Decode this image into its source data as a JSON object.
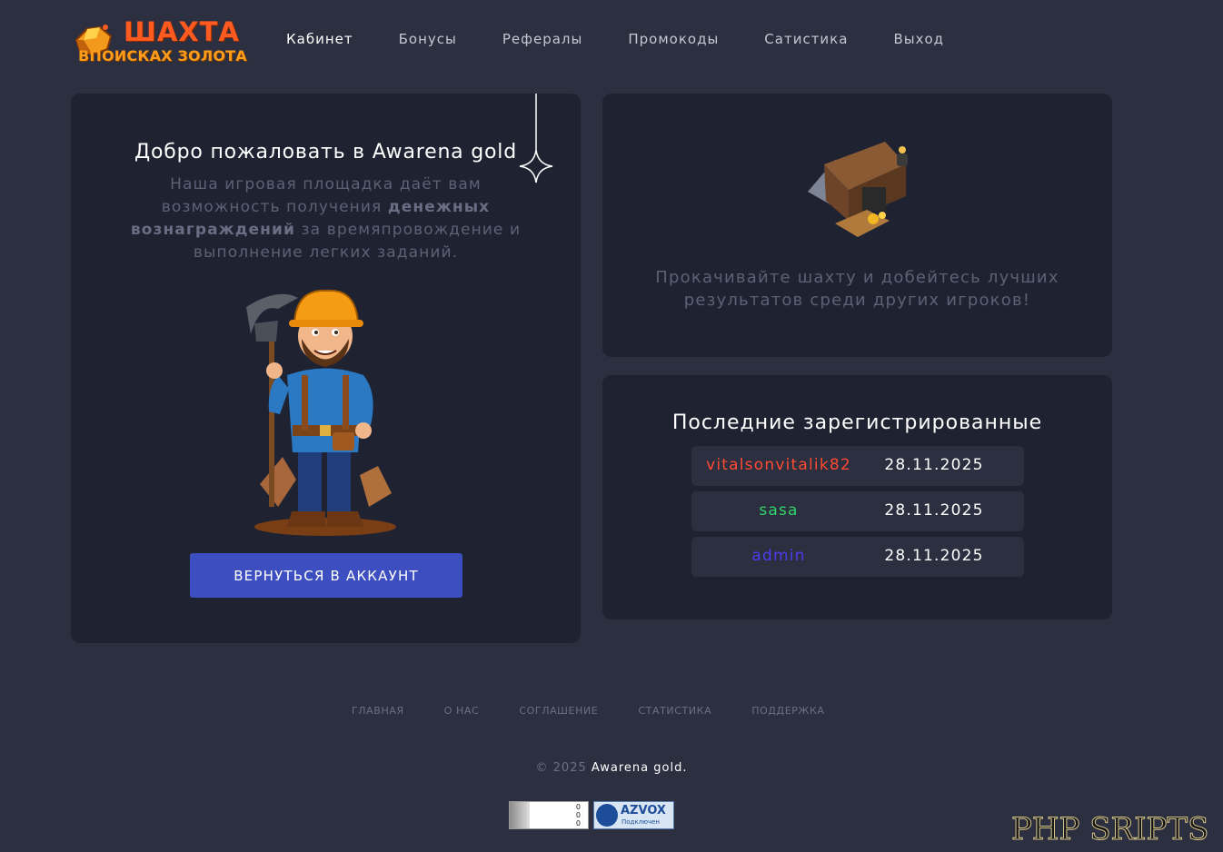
{
  "header": {
    "logo_title": "ШАХТА",
    "logo_subtitle": "ВПОИСКАХ ЗОЛОТА",
    "nav": [
      {
        "label": "Кабинет",
        "active": true
      },
      {
        "label": "Бонусы",
        "active": false
      },
      {
        "label": "Рефералы",
        "active": false
      },
      {
        "label": "Промокоды",
        "active": false
      },
      {
        "label": "Сатистика",
        "active": false
      },
      {
        "label": "Выход",
        "active": false
      }
    ]
  },
  "welcome": {
    "title": "Добро пожаловать в Awarena gold",
    "text_before": "Наша игровая площадка даёт вам возможность получения ",
    "text_bold": "денежных вознаграждений",
    "text_after": " за времяпровождение и выполнение легких заданий.",
    "button_label": "ВЕРНУТЬСЯ В АККАУНТ"
  },
  "mine_card": {
    "text": "Прокачивайте шахту и добейтесь лучших результатов среди других игроков!"
  },
  "recent": {
    "title": "Последние зарегистрированные",
    "users": [
      {
        "name": "vitalsonvitalik82",
        "date": "28.11.2025",
        "color": "#ff4a32"
      },
      {
        "name": "sasa",
        "date": "28.11.2025",
        "color": "#2fd46b"
      },
      {
        "name": "admin",
        "date": "28.11.2025",
        "color": "#4c3cf0"
      }
    ]
  },
  "footer": {
    "links": [
      "ГЛАВНАЯ",
      "О НАС",
      "СОГЛАШЕНИЕ",
      "СТАТИСТИКА",
      "ПОДДЕРЖКА"
    ],
    "copyright_prefix": "© 2025",
    "copyright_brand": "Awarena gold.",
    "counter_values": [
      "0",
      "0",
      "0"
    ],
    "azvox_name": "AZVOX",
    "azvox_status": "Подключен"
  },
  "watermark": "PHP SRIPTS",
  "colors": {
    "background": "#2c2f3f",
    "card": "#1f2231",
    "button": "#3d4fc0",
    "logo": "#ff5a1f"
  }
}
